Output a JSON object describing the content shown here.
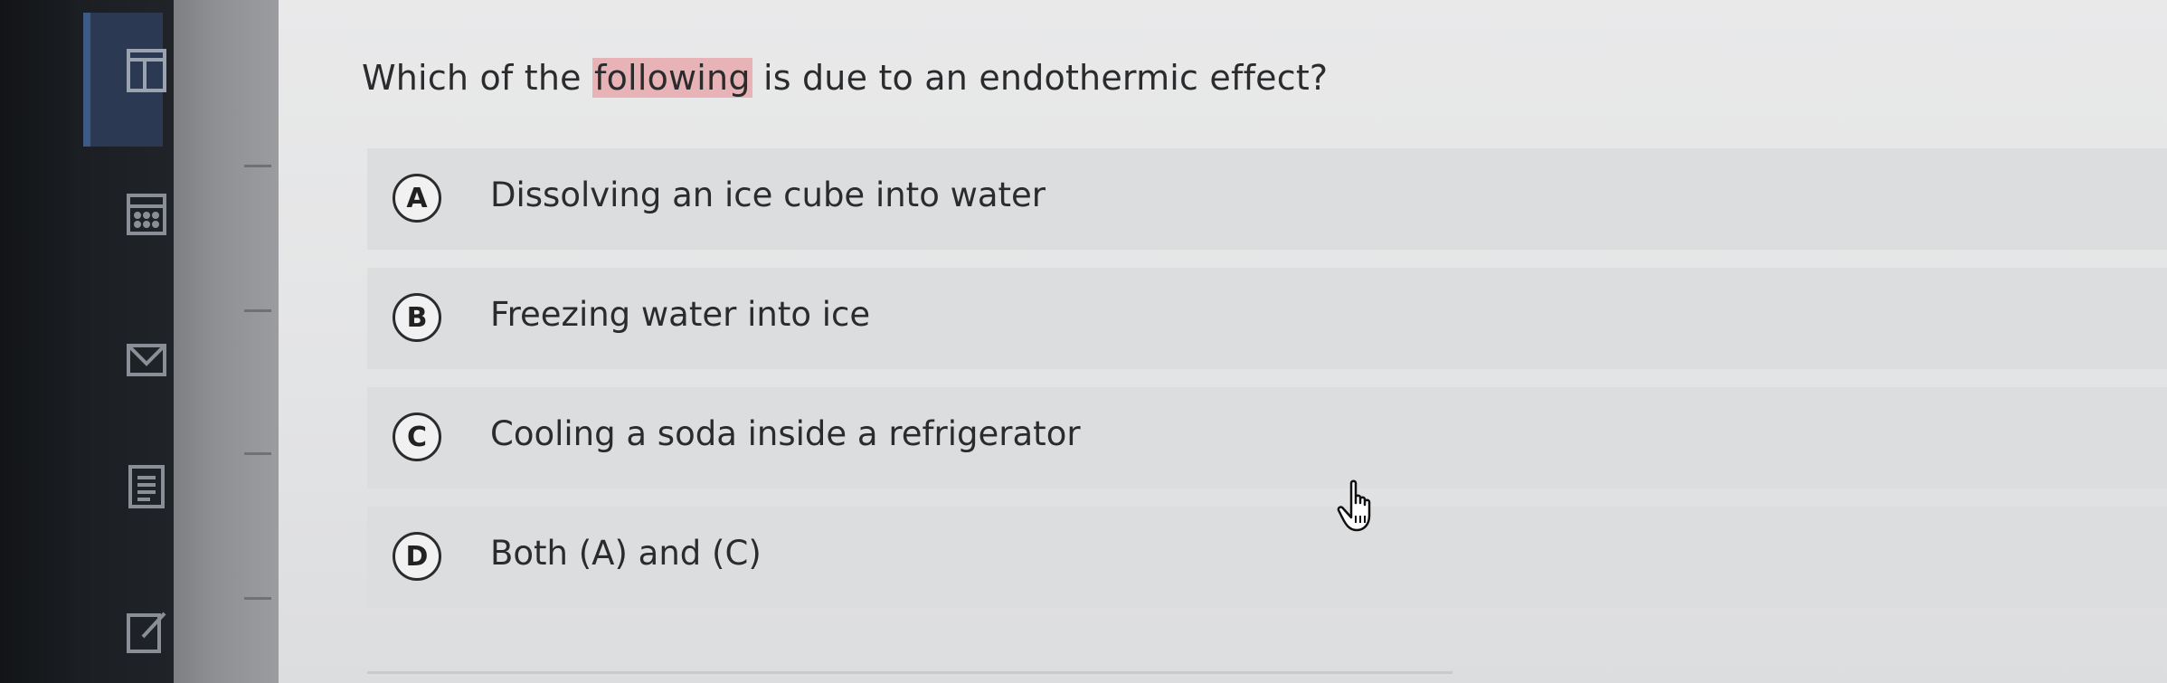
{
  "question": {
    "before": "Which of the ",
    "highlighted": "following",
    "after": " is due to an endothermic effect?"
  },
  "options": [
    {
      "letter": "A",
      "text": "Dissolving an ice cube into water"
    },
    {
      "letter": "B",
      "text": "Freezing water into ice"
    },
    {
      "letter": "C",
      "text": "Cooling a soda inside a refrigerator"
    },
    {
      "letter": "D",
      "text": "Both (A) and (C)"
    }
  ],
  "sidebar": {
    "icons": [
      "panel-layout-icon",
      "calculator-icon",
      "mail-icon",
      "notes-icon",
      "edit-icon"
    ]
  },
  "colors": {
    "highlight": "#e8b3b6",
    "panel_background": "#e4e5e6",
    "option_background": "#dcdddf",
    "rail_background": "#1b1e22",
    "rail_active": "#2b3a52"
  }
}
